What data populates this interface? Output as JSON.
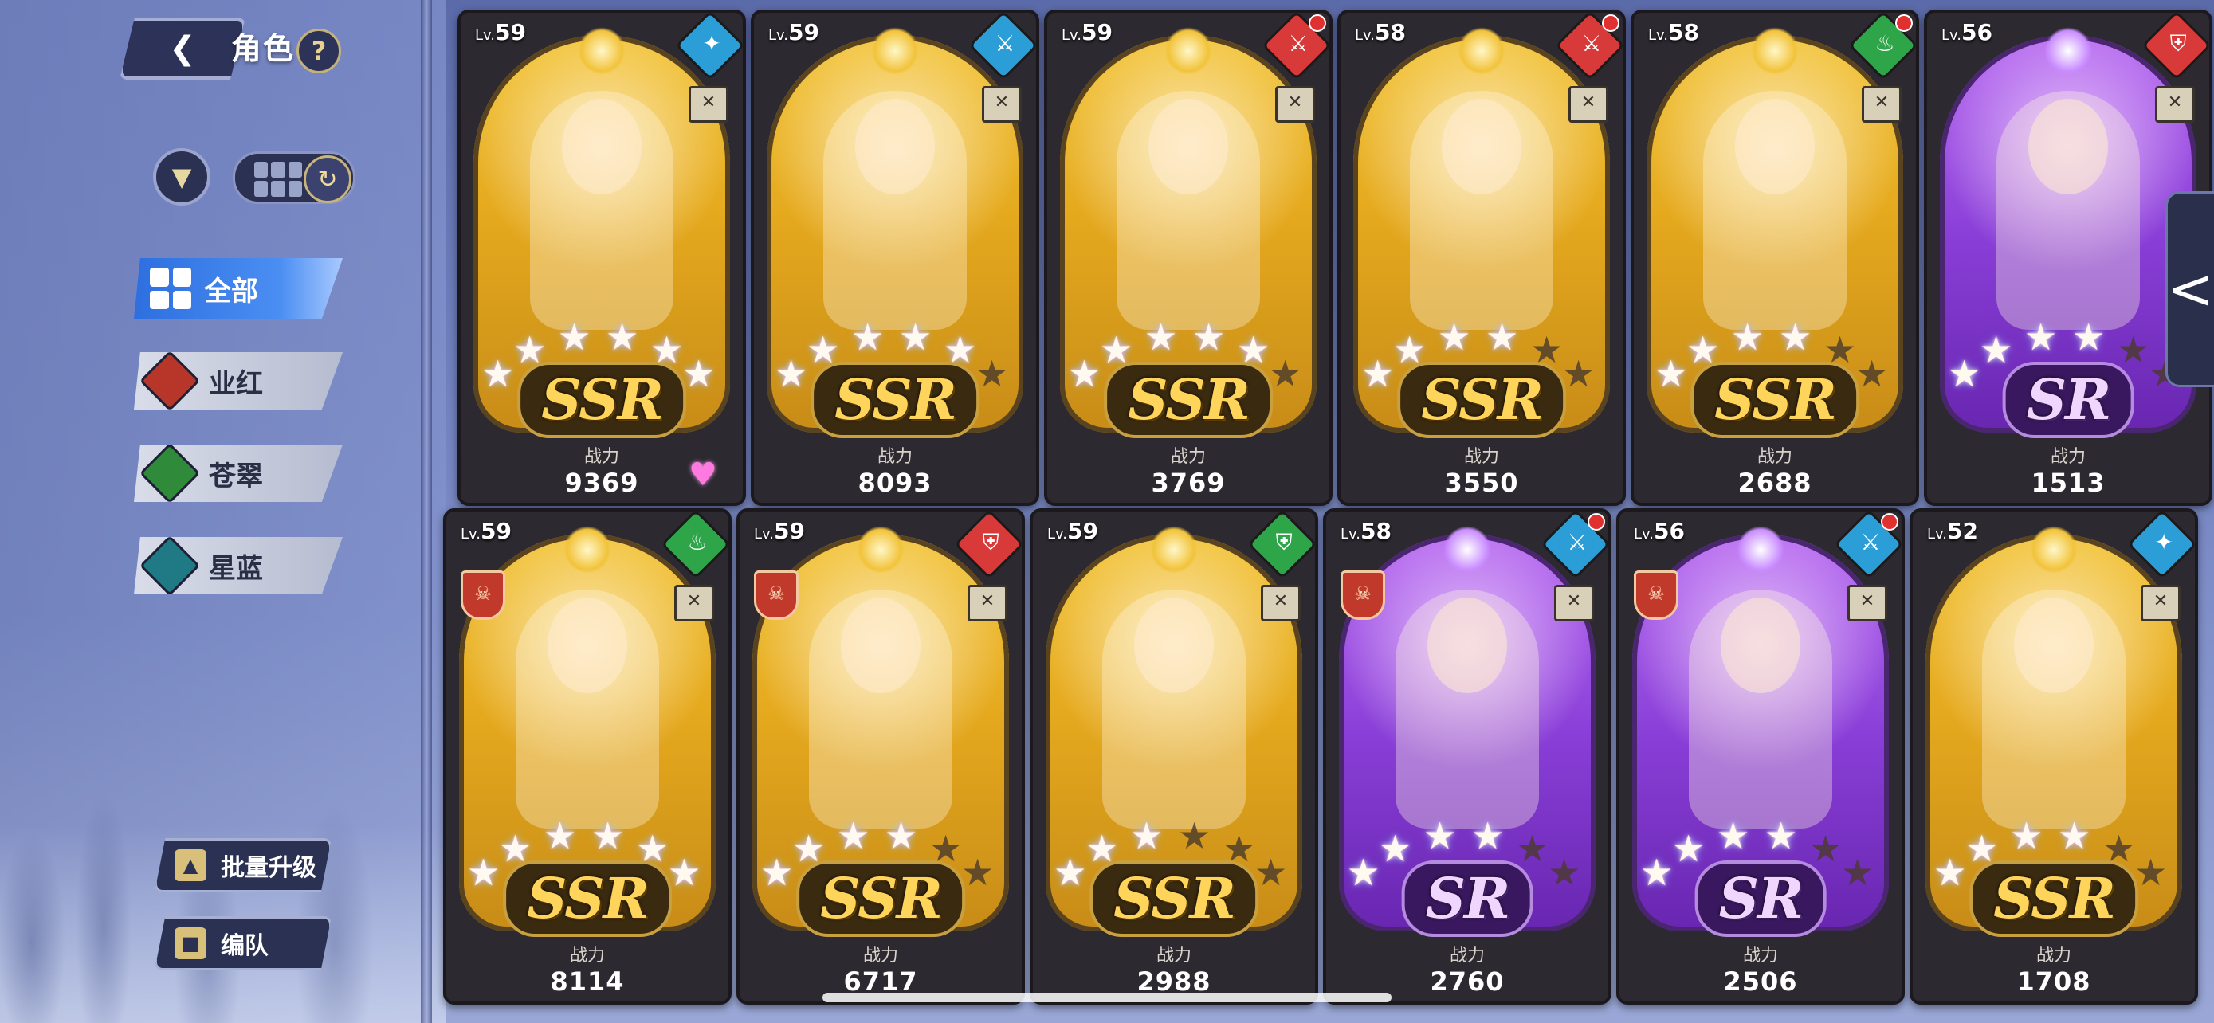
{
  "header": {
    "title": "角色",
    "back_icon": "back-arrow-icon",
    "help_label": "?"
  },
  "tools": {
    "filter_icon": "funnel-icon",
    "view_icon": "grid-icon",
    "refresh_icon": "refresh-icon"
  },
  "categories": [
    {
      "label": "全部",
      "active": true,
      "color": "#3a7de6"
    },
    {
      "label": "业红",
      "active": false,
      "color": "#c0392b"
    },
    {
      "label": "苍翠",
      "active": false,
      "color": "#2e8b3a"
    },
    {
      "label": "星蓝",
      "active": false,
      "color": "#1f7a86"
    }
  ],
  "bottom_buttons": [
    {
      "label": "批量升级",
      "icon": "upgrade-icon"
    },
    {
      "label": "编队",
      "icon": "formation-icon"
    }
  ],
  "power_label": "战力",
  "lv_prefix": "Lv.",
  "cards": [
    {
      "level": "59",
      "rarity": "SSR",
      "power": "9369",
      "stars": 6,
      "max_stars": 6,
      "class_color": "#2b9ed8",
      "class_icon": "staff-icon",
      "dot": false,
      "emblem": false,
      "heart": true
    },
    {
      "level": "59",
      "rarity": "SSR",
      "power": "8093",
      "stars": 5,
      "max_stars": 6,
      "class_color": "#2b9ed8",
      "class_icon": "sword-icon",
      "dot": false,
      "emblem": false,
      "heart": false
    },
    {
      "level": "59",
      "rarity": "SSR",
      "power": "3769",
      "stars": 5,
      "max_stars": 6,
      "class_color": "#d83a3a",
      "class_icon": "sword-icon",
      "dot": true,
      "emblem": false,
      "heart": false
    },
    {
      "level": "58",
      "rarity": "SSR",
      "power": "3550",
      "stars": 4,
      "max_stars": 6,
      "class_color": "#d83a3a",
      "class_icon": "sword-icon",
      "dot": true,
      "emblem": false,
      "heart": false
    },
    {
      "level": "58",
      "rarity": "SSR",
      "power": "2688",
      "stars": 4,
      "max_stars": 6,
      "class_color": "#2fa54a",
      "class_icon": "flame-icon",
      "dot": true,
      "emblem": false,
      "heart": false
    },
    {
      "level": "56",
      "rarity": "SR",
      "power": "1513",
      "stars": 4,
      "max_stars": 6,
      "class_color": "#d83a3a",
      "class_icon": "shield-icon",
      "dot": false,
      "emblem": false,
      "heart": false
    },
    {
      "level": "59",
      "rarity": "SSR",
      "power": "8114",
      "stars": 6,
      "max_stars": 6,
      "class_color": "#2fa54a",
      "class_icon": "flame-icon",
      "dot": false,
      "emblem": true,
      "heart": false
    },
    {
      "level": "59",
      "rarity": "SSR",
      "power": "6717",
      "stars": 4,
      "max_stars": 6,
      "class_color": "#d83a3a",
      "class_icon": "shield-icon",
      "dot": false,
      "emblem": true,
      "heart": false
    },
    {
      "level": "59",
      "rarity": "SSR",
      "power": "2988",
      "stars": 3,
      "max_stars": 6,
      "class_color": "#2fa54a",
      "class_icon": "shield-icon",
      "dot": false,
      "emblem": false,
      "heart": false
    },
    {
      "level": "58",
      "rarity": "SR",
      "power": "2760",
      "stars": 4,
      "max_stars": 6,
      "class_color": "#2b9ed8",
      "class_icon": "sword-icon",
      "dot": true,
      "emblem": true,
      "heart": false
    },
    {
      "level": "56",
      "rarity": "SR",
      "power": "2506",
      "stars": 4,
      "max_stars": 6,
      "class_color": "#2b9ed8",
      "class_icon": "sword-icon",
      "dot": true,
      "emblem": true,
      "heart": false
    },
    {
      "level": "52",
      "rarity": "SSR",
      "power": "1708",
      "stars": 4,
      "max_stars": 6,
      "class_color": "#2b9ed8",
      "class_icon": "staff-icon",
      "dot": false,
      "emblem": false,
      "heart": false
    }
  ],
  "side_arrow_label": "<"
}
